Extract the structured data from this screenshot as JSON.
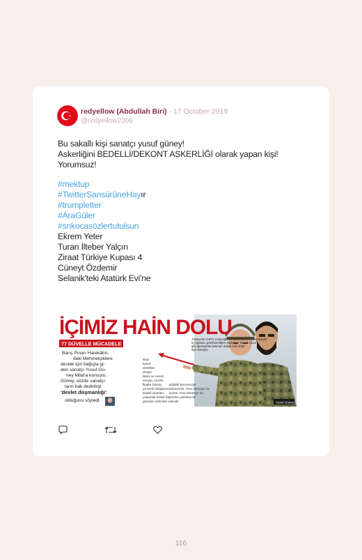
{
  "tweet": {
    "display_name": "redyellow (Abdullah Biri)",
    "separator": "·",
    "date": "17 October 2019",
    "handle": "@redyellow2006",
    "lines": [
      "Bu sakallı kişi sanatçı yusuf güney!",
      "Askerliğini BEDELLİ/DEKONT ASKERLİĞİ olarak yapan kişi!",
      "Yorumsuz!",
      "."
    ],
    "hashtags": [
      "#mektup",
      "#TwitterSansürüneHay",
      "#trumpletter",
      "#AraGüler",
      "#snkocasözlertutulsun"
    ],
    "hashtag_suffix": "ır",
    "trends": [
      "Ekrem Yeter",
      "Turan İlteber Yalçın",
      "Ziraat Türkiye Kupası 4",
      "Cüneyt Özdemir",
      "Selanik'teki Atatürk Evi'ne"
    ]
  },
  "newspaper": {
    "headline": "İÇİMİZ HAİN DOLU",
    "kicker": "77 DÜVELLE MÜCADELE",
    "left_column": [
      "Barış Pınarı Harekâtın-",
      "daki Mehmetçiklere",
      "destek için bağışta gi-",
      "den sanatçı Yusuf Gü-",
      "ney Milat'a konuştu.",
      "Güney, sözde sanatçı-",
      "ların hak dedirtirip",
      "'devlet düşmanlığı'",
      "olduğunu söyledi"
    ],
    "bold_lines": [
      "'devlet düşmanlığı'"
    ],
    "inset_text": [
      "Türkiye'de CHP'li, İmamoğlu ve Barış Şüphe'i yorumlarıyla",
      "bu toplumu gözlemlediğine söyleyen \"Biz de cesur\"",
      "gibi iğrençlerde bulunan doğun belli değil\"",
      "diye konuştu."
    ],
    "middle_text": [
      "Başı",
      "sanat",
      "destekte",
      "dırıştır.",
      "Barış ve evveli",
      "tanışıp, evvela",
      "fiyatla Güney, ",
      "ya tanık olduğumu",
      "kişisel çıkarları-"
    ],
    "middle_text2": [
      "şiddetli koruma gör",
      "tahanecek. Ama dürüstçe bu",
      "içmek. Ama dürüstçe bu",
      "yaşamak koltuk baştırılsın gösterecek",
      "güneşin ardından edecek"
    ],
    "credit": "Yusuf Güney"
  },
  "actions": [
    "reply-icon",
    "retweet-icon",
    "like-icon"
  ],
  "page_number": "116",
  "colors": {
    "background": "#f7f0ea",
    "card": "#ffffff",
    "name": "#8a2b48",
    "meta": "#c7a7b0",
    "hashtag": "#4aa3df",
    "flag_red": "#e30a17",
    "headline_red": "#c8141e"
  }
}
